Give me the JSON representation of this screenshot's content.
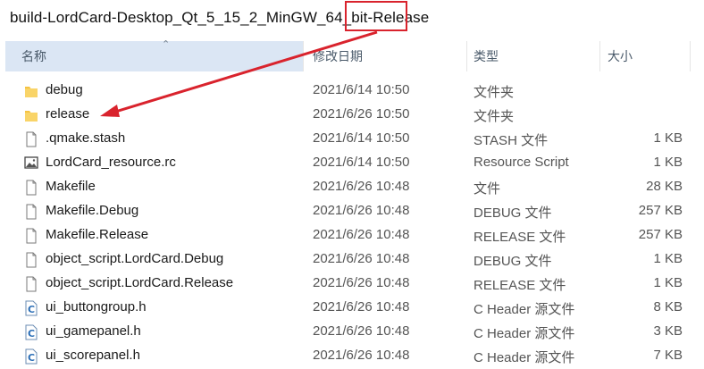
{
  "address_bar": {
    "path_prefix": "build-LordCard-Desktop_Qt_5_15_2_MinGW_64_bit-",
    "path_highlight": "Release"
  },
  "columns": {
    "name": "名称",
    "date": "修改日期",
    "type": "类型",
    "size": "大小"
  },
  "files": [
    {
      "name": "debug",
      "date": "2021/6/14 10:50",
      "type": "文件夹",
      "size": "",
      "icon": "folder-icon"
    },
    {
      "name": "release",
      "date": "2021/6/26 10:50",
      "type": "文件夹",
      "size": "",
      "icon": "folder-icon"
    },
    {
      "name": ".qmake.stash",
      "date": "2021/6/14 10:50",
      "type": "STASH 文件",
      "size": "1 KB",
      "icon": "file-icon"
    },
    {
      "name": "LordCard_resource.rc",
      "date": "2021/6/14 10:50",
      "type": "Resource Script",
      "size": "1 KB",
      "icon": "image-file-icon"
    },
    {
      "name": "Makefile",
      "date": "2021/6/26 10:48",
      "type": "文件",
      "size": "28 KB",
      "icon": "file-icon"
    },
    {
      "name": "Makefile.Debug",
      "date": "2021/6/26 10:48",
      "type": "DEBUG 文件",
      "size": "257 KB",
      "icon": "file-icon"
    },
    {
      "name": "Makefile.Release",
      "date": "2021/6/26 10:48",
      "type": "RELEASE 文件",
      "size": "257 KB",
      "icon": "file-icon"
    },
    {
      "name": "object_script.LordCard.Debug",
      "date": "2021/6/26 10:48",
      "type": "DEBUG 文件",
      "size": "1 KB",
      "icon": "file-icon"
    },
    {
      "name": "object_script.LordCard.Release",
      "date": "2021/6/26 10:48",
      "type": "RELEASE 文件",
      "size": "1 KB",
      "icon": "file-icon"
    },
    {
      "name": "ui_buttongroup.h",
      "date": "2021/6/26 10:48",
      "type": "C Header 源文件",
      "size": "8 KB",
      "icon": "c-header-icon"
    },
    {
      "name": "ui_gamepanel.h",
      "date": "2021/6/26 10:48",
      "type": "C Header 源文件",
      "size": "3 KB",
      "icon": "c-header-icon"
    },
    {
      "name": "ui_scorepanel.h",
      "date": "2021/6/26 10:48",
      "type": "C Header 源文件",
      "size": "7 KB",
      "icon": "c-header-icon"
    }
  ],
  "colors": {
    "annotation_red": "#d9232d",
    "header_selected": "#dbe6f4",
    "folder_yellow": "#f5c342"
  }
}
